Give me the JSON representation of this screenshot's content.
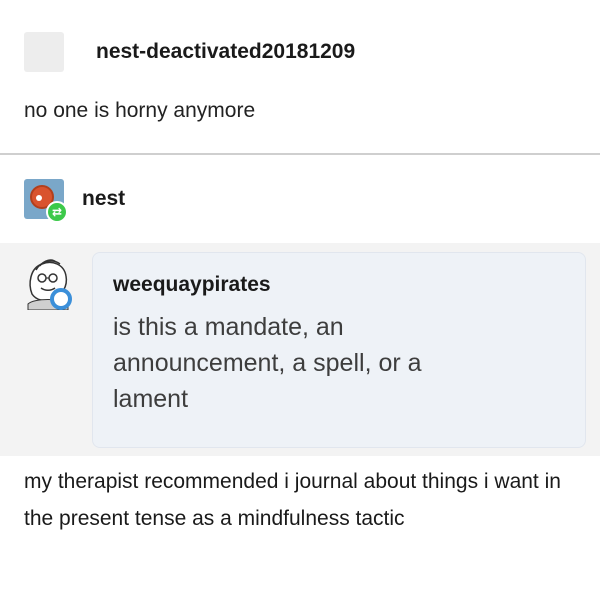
{
  "original_post": {
    "username": "nest-deactivated20181209",
    "text": "no one is horny anymore"
  },
  "reblog": {
    "username": "nest",
    "reply": "my therapist recommended i journal about things i want in the present tense as a mindfulness tactic"
  },
  "ask": {
    "asker": "weequaypirates",
    "question": "is this a mandate, an announcement, a spell, or a lament"
  },
  "icons": {
    "reblog_badge": "reblog-icon",
    "asker_badge": "ask-indicator-icon"
  },
  "colors": {
    "reblog_green": "#3cc94a",
    "ask_blue": "#3b8fd9",
    "ask_bubble_bg": "#eef2f7"
  }
}
